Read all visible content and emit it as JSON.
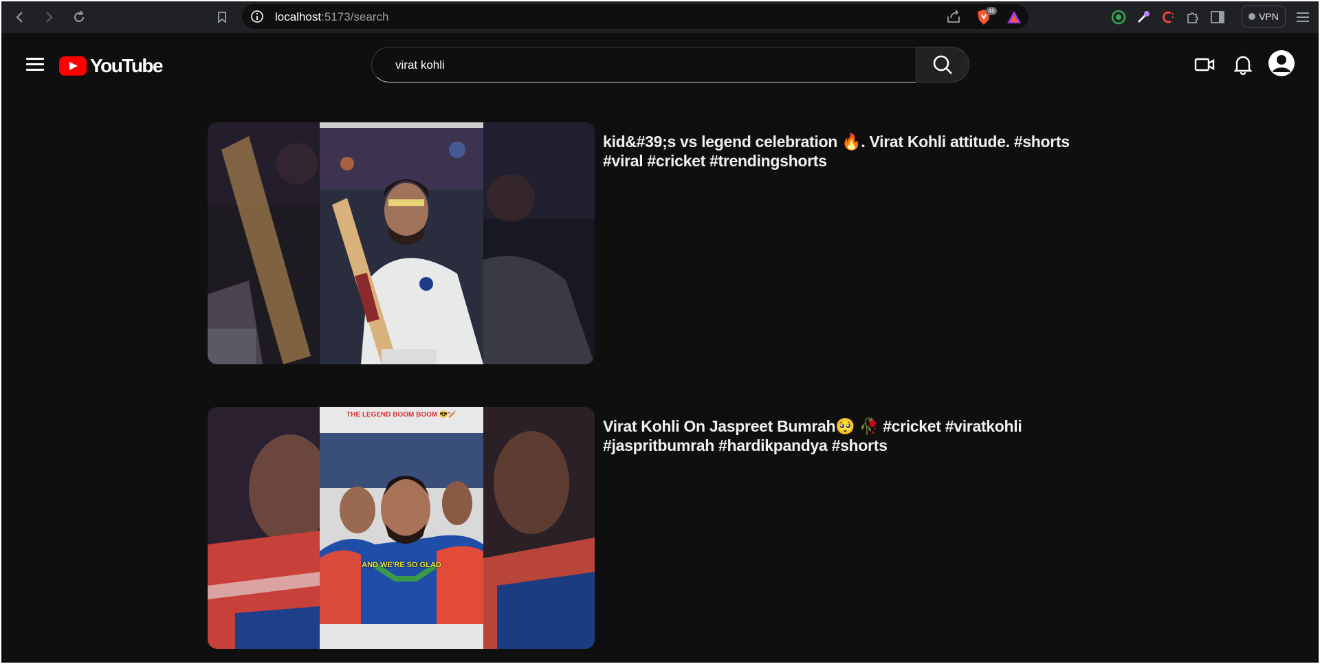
{
  "browser": {
    "url_host": "localhost",
    "url_path": ":5173/search",
    "shield_count": "46",
    "vpn_label": "VPN"
  },
  "header": {
    "logo_text": "YouTube",
    "search_value": "virat kohli"
  },
  "results": [
    {
      "title": "kid&#39;s vs legend celebration 🔥. Virat Kohli attitude. #shorts #viral #cricket #trendingshorts"
    },
    {
      "title": "Virat Kohli On Jaspreet Bumrah🥺 🥀 #cricket #viratkohli #jaspritbumrah #hardikpandya #shorts",
      "thumb_caption_top": "THE LEGEND BOOM BOOM 😎🏏",
      "thumb_caption_mid": "AND WE'RE SO GLAD"
    }
  ],
  "colors": {
    "page_bg": "#0f0f0f",
    "brand_red": "#ff0000"
  }
}
